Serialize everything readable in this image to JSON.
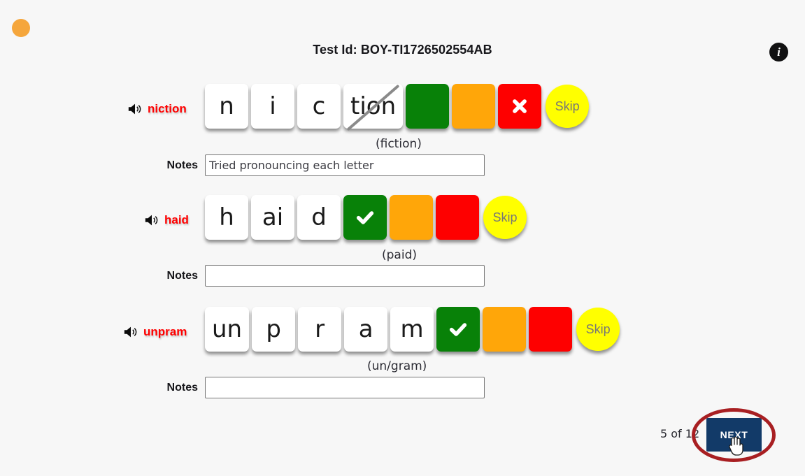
{
  "header": {
    "title": "Test Id: BOY-TI1726502554AB",
    "info_icon": "info-icon",
    "status_dot_color": "#f5a63c"
  },
  "notes_label": "Notes",
  "skip_label": "Skip",
  "colors": {
    "green": "#088108",
    "orange": "#ffa609",
    "red": "#fe0000",
    "yellow": "#ffff00",
    "word_red": "#ff0000",
    "next_blue": "#123a68",
    "highlight_red": "#a81f22"
  },
  "rows": [
    {
      "word": "niction",
      "speaker_icon": "speaker-icon",
      "tiles": [
        {
          "text": "n",
          "struck": false
        },
        {
          "text": "i",
          "struck": false
        },
        {
          "text": "c",
          "struck": false
        },
        {
          "text": "tion",
          "struck": true
        }
      ],
      "marks": [
        {
          "color": "green",
          "state": "unselected",
          "icon": "none"
        },
        {
          "color": "orange",
          "state": "unselected",
          "icon": "none"
        },
        {
          "color": "red",
          "state": "selected",
          "icon": "cross-icon"
        }
      ],
      "skip": "Skip",
      "answer_hint": "(fiction)",
      "notes_value": "Tried pronouncing each letter",
      "notes_placeholder": ""
    },
    {
      "word": "haid",
      "speaker_icon": "speaker-icon",
      "tiles": [
        {
          "text": "h",
          "struck": false
        },
        {
          "text": "ai",
          "struck": false
        },
        {
          "text": "d",
          "struck": false
        }
      ],
      "marks": [
        {
          "color": "green",
          "state": "selected",
          "icon": "check-icon"
        },
        {
          "color": "orange",
          "state": "unselected",
          "icon": "none"
        },
        {
          "color": "red",
          "state": "unselected",
          "icon": "none"
        }
      ],
      "skip": "Skip",
      "answer_hint": "(paid)",
      "notes_value": "",
      "notes_placeholder": ""
    },
    {
      "word": "unpram",
      "speaker_icon": "speaker-icon",
      "tiles": [
        {
          "text": "un",
          "struck": false
        },
        {
          "text": "p",
          "struck": false
        },
        {
          "text": "r",
          "struck": false
        },
        {
          "text": "a",
          "struck": false
        },
        {
          "text": "m",
          "struck": false
        }
      ],
      "marks": [
        {
          "color": "green",
          "state": "selected",
          "icon": "check-icon"
        },
        {
          "color": "orange",
          "state": "unselected",
          "icon": "none"
        },
        {
          "color": "red",
          "state": "unselected",
          "icon": "none"
        }
      ],
      "skip": "Skip",
      "answer_hint": "(un/gram)",
      "notes_value": "",
      "notes_placeholder": ""
    }
  ],
  "footer": {
    "page_counter": "5 of 12",
    "next_label": "NEXT"
  }
}
